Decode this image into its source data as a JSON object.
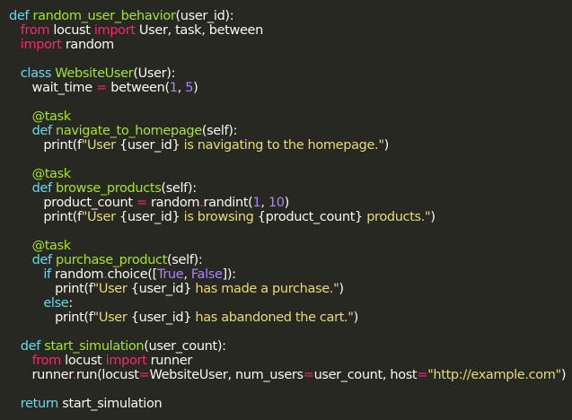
{
  "theme": {
    "background": "#272822",
    "text": "#f8f8f2",
    "keyword_pink": "#f92672",
    "keyword_cyan": "#66d9ef",
    "name_green": "#a6e22e",
    "string_yellow": "#e6db74",
    "number_purple": "#ae81ff"
  },
  "code": {
    "lines": [
      [
        [
          "st",
          "def"
        ],
        [
          "pl",
          " "
        ],
        [
          "fn",
          "random_user_behavior"
        ],
        [
          "pl",
          "(user_id):"
        ]
      ],
      [
        [
          "pl",
          "   "
        ],
        [
          "kw",
          "from"
        ],
        [
          "pl",
          " locust "
        ],
        [
          "kw",
          "import"
        ],
        [
          "pl",
          " User, task, between"
        ]
      ],
      [
        [
          "pl",
          "   "
        ],
        [
          "kw",
          "import"
        ],
        [
          "pl",
          " random"
        ]
      ],
      [],
      [
        [
          "pl",
          "   "
        ],
        [
          "st",
          "class"
        ],
        [
          "pl",
          " "
        ],
        [
          "fn",
          "WebsiteUser"
        ],
        [
          "pl",
          "(User):"
        ]
      ],
      [
        [
          "pl",
          "      wait_time "
        ],
        [
          "op",
          "="
        ],
        [
          "pl",
          " between("
        ],
        [
          "num",
          "1"
        ],
        [
          "pl",
          ", "
        ],
        [
          "num",
          "5"
        ],
        [
          "pl",
          ")"
        ]
      ],
      [],
      [
        [
          "pl",
          "      "
        ],
        [
          "fn",
          "@task"
        ]
      ],
      [
        [
          "pl",
          "      "
        ],
        [
          "st",
          "def"
        ],
        [
          "pl",
          " "
        ],
        [
          "fn",
          "navigate_to_homepage"
        ],
        [
          "pl",
          "(self):"
        ]
      ],
      [
        [
          "pl",
          "         print(f"
        ],
        [
          "str",
          "\"User "
        ],
        [
          "pl",
          "{user_id}"
        ],
        [
          "str",
          " is navigating to the homepage.\""
        ],
        [
          "pl",
          ")"
        ]
      ],
      [],
      [
        [
          "pl",
          "      "
        ],
        [
          "fn",
          "@task"
        ]
      ],
      [
        [
          "pl",
          "      "
        ],
        [
          "st",
          "def"
        ],
        [
          "pl",
          " "
        ],
        [
          "fn",
          "browse_products"
        ],
        [
          "pl",
          "(self):"
        ]
      ],
      [
        [
          "pl",
          "         product_count "
        ],
        [
          "op",
          "="
        ],
        [
          "pl",
          " random"
        ],
        [
          "op",
          "."
        ],
        [
          "pl",
          "randint("
        ],
        [
          "num",
          "1"
        ],
        [
          "pl",
          ", "
        ],
        [
          "num",
          "10"
        ],
        [
          "pl",
          ")"
        ]
      ],
      [
        [
          "pl",
          "         print(f"
        ],
        [
          "str",
          "\"User "
        ],
        [
          "pl",
          "{user_id}"
        ],
        [
          "str",
          " is browsing "
        ],
        [
          "pl",
          "{product_count}"
        ],
        [
          "str",
          " products.\""
        ],
        [
          "pl",
          ")"
        ]
      ],
      [],
      [
        [
          "pl",
          "      "
        ],
        [
          "fn",
          "@task"
        ]
      ],
      [
        [
          "pl",
          "      "
        ],
        [
          "st",
          "def"
        ],
        [
          "pl",
          " "
        ],
        [
          "fn",
          "purchase_product"
        ],
        [
          "pl",
          "(self):"
        ]
      ],
      [
        [
          "pl",
          "         "
        ],
        [
          "st",
          "if"
        ],
        [
          "pl",
          " random"
        ],
        [
          "op",
          "."
        ],
        [
          "pl",
          "choice(["
        ],
        [
          "num",
          "True"
        ],
        [
          "pl",
          ", "
        ],
        [
          "num",
          "False"
        ],
        [
          "pl",
          "]):"
        ]
      ],
      [
        [
          "pl",
          "            print(f"
        ],
        [
          "str",
          "\"User "
        ],
        [
          "pl",
          "{user_id}"
        ],
        [
          "str",
          " has made a purchase.\""
        ],
        [
          "pl",
          ")"
        ]
      ],
      [
        [
          "pl",
          "         "
        ],
        [
          "st",
          "else"
        ],
        [
          "pl",
          ":"
        ]
      ],
      [
        [
          "pl",
          "            print(f"
        ],
        [
          "str",
          "\"User "
        ],
        [
          "pl",
          "{user_id}"
        ],
        [
          "str",
          " has abandoned the cart.\""
        ],
        [
          "pl",
          ")"
        ]
      ],
      [],
      [
        [
          "pl",
          "   "
        ],
        [
          "st",
          "def"
        ],
        [
          "pl",
          " "
        ],
        [
          "fn",
          "start_simulation"
        ],
        [
          "pl",
          "(user_count):"
        ]
      ],
      [
        [
          "pl",
          "      "
        ],
        [
          "kw",
          "from"
        ],
        [
          "pl",
          " locust "
        ],
        [
          "kw",
          "import"
        ],
        [
          "pl",
          " runner"
        ]
      ],
      [
        [
          "pl",
          "      runner"
        ],
        [
          "op",
          "."
        ],
        [
          "pl",
          "run(locust"
        ],
        [
          "op",
          "="
        ],
        [
          "pl",
          "WebsiteUser, num_users"
        ],
        [
          "op",
          "="
        ],
        [
          "pl",
          "user_count, host"
        ],
        [
          "op",
          "="
        ],
        [
          "str",
          "\"http://example.com\""
        ],
        [
          "pl",
          ")"
        ]
      ],
      [],
      [
        [
          "pl",
          "   "
        ],
        [
          "st",
          "return"
        ],
        [
          "pl",
          " start_simulation"
        ]
      ]
    ]
  }
}
